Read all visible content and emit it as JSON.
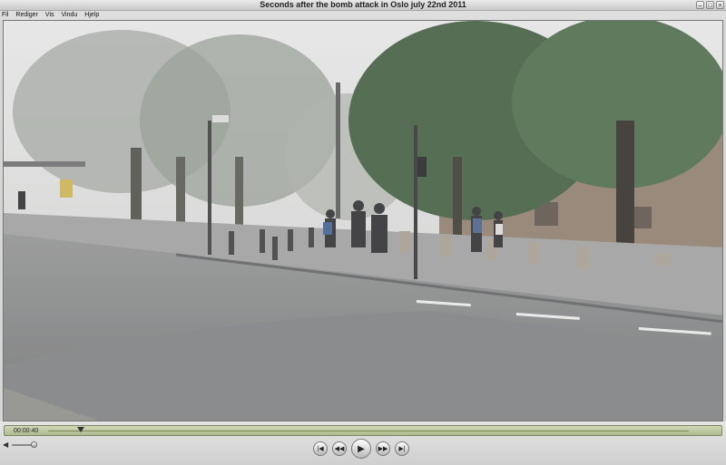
{
  "window": {
    "title": "Seconds after the bomb attack in Oslo july 22nd 2011"
  },
  "menu": {
    "items": [
      "Fil",
      "Rediger",
      "Vis",
      "Vindu",
      "Hjelp"
    ]
  },
  "player": {
    "time": "00:00:40",
    "progress_fraction": 0.106,
    "volume_fraction": 0.85
  },
  "icons": {
    "minimize": "minimize-icon",
    "maximize": "maximize-icon",
    "close": "close-icon",
    "volume": "speaker-icon",
    "skip_back": "skip-to-start-icon",
    "rewind": "rewind-icon",
    "play": "play-icon",
    "fast_forward": "fast-forward-icon",
    "skip_forward": "skip-to-end-icon"
  },
  "colors": {
    "timeline": "#c4cda8",
    "chrome": "#d6d6d6"
  }
}
